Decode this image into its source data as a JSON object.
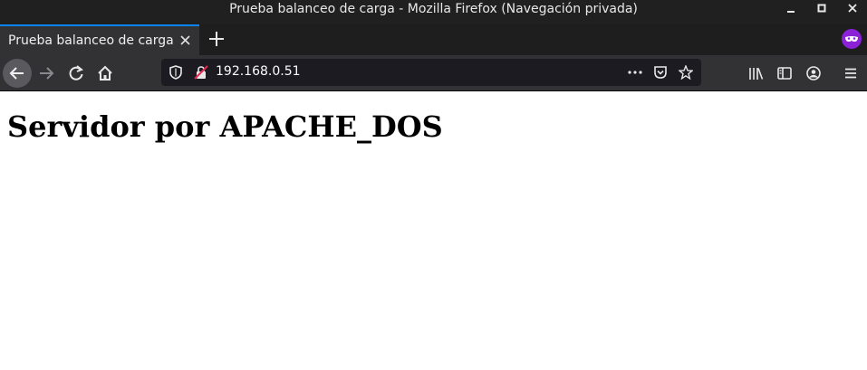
{
  "window": {
    "title": "Prueba balanceo de carga - Mozilla Firefox (Navegación privada)"
  },
  "tabs": [
    {
      "label": "Prueba balanceo de carga",
      "active": true
    }
  ],
  "navbar": {
    "url": "192.168.0.51"
  },
  "page": {
    "heading": "Servidor por APACHE_DOS"
  },
  "colors": {
    "accent": "#0a84ff",
    "private": "#8b22d8"
  }
}
